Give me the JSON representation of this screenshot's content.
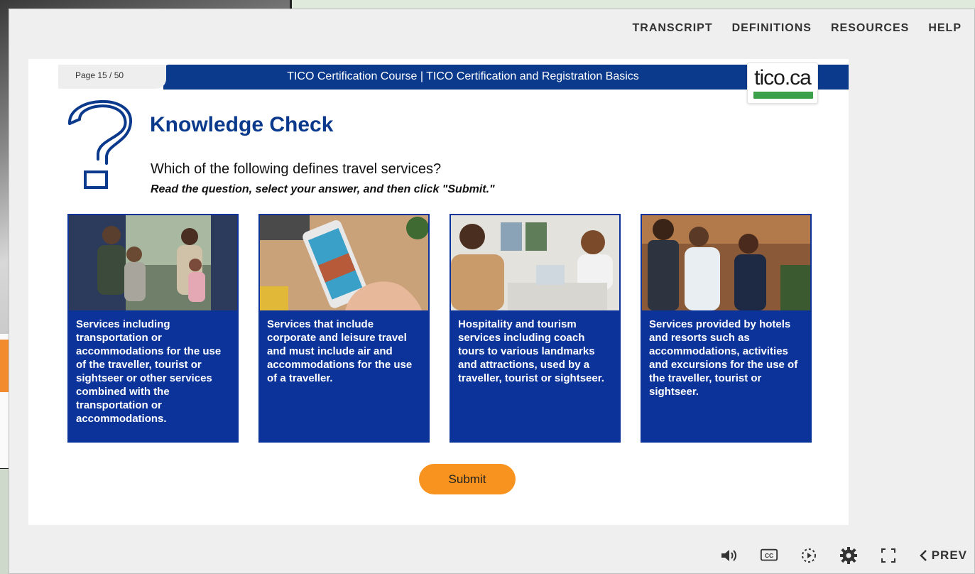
{
  "topnav": {
    "transcript": "TRANSCRIPT",
    "definitions": "DEFINITIONS",
    "resources": "RESOURCES",
    "help": "HELP"
  },
  "slide": {
    "page_label": "Page 15 / 50",
    "header_title": "TICO Certification Course | TICO Certification and Registration Basics",
    "logo_text": "tico.ca",
    "title": "Knowledge Check",
    "question": "Which of the following defines travel services?",
    "instruction": "Read the question, select your answer, and then click \"Submit.\"",
    "options": [
      {
        "text": "Services including transportation or accommodations for the use of the traveller, tourist or sightseer or other services combined with the transportation or accommodations."
      },
      {
        "text": "Services that include corporate and leisure travel and must include air and accommodations for the use of a traveller."
      },
      {
        "text": "Hospitality and tourism services including coach tours to various landmarks and attractions, used by a traveller, tourist or sightseer."
      },
      {
        "text": "Services provided by hotels and resorts such as accommodations, activities and excursions for the use of the traveller, tourist or sightseer."
      }
    ],
    "submit_label": "Submit"
  },
  "controls": {
    "icons": [
      "volume-icon",
      "closed-captions-icon",
      "playback-speed-icon",
      "settings-gear-icon",
      "fullscreen-icon"
    ],
    "prev_label": "PREV"
  },
  "colors": {
    "brand_blue": "#0b3a8c",
    "card_blue": "#0b3399",
    "submit_orange": "#f7931e",
    "logo_green": "#3aa14a"
  }
}
